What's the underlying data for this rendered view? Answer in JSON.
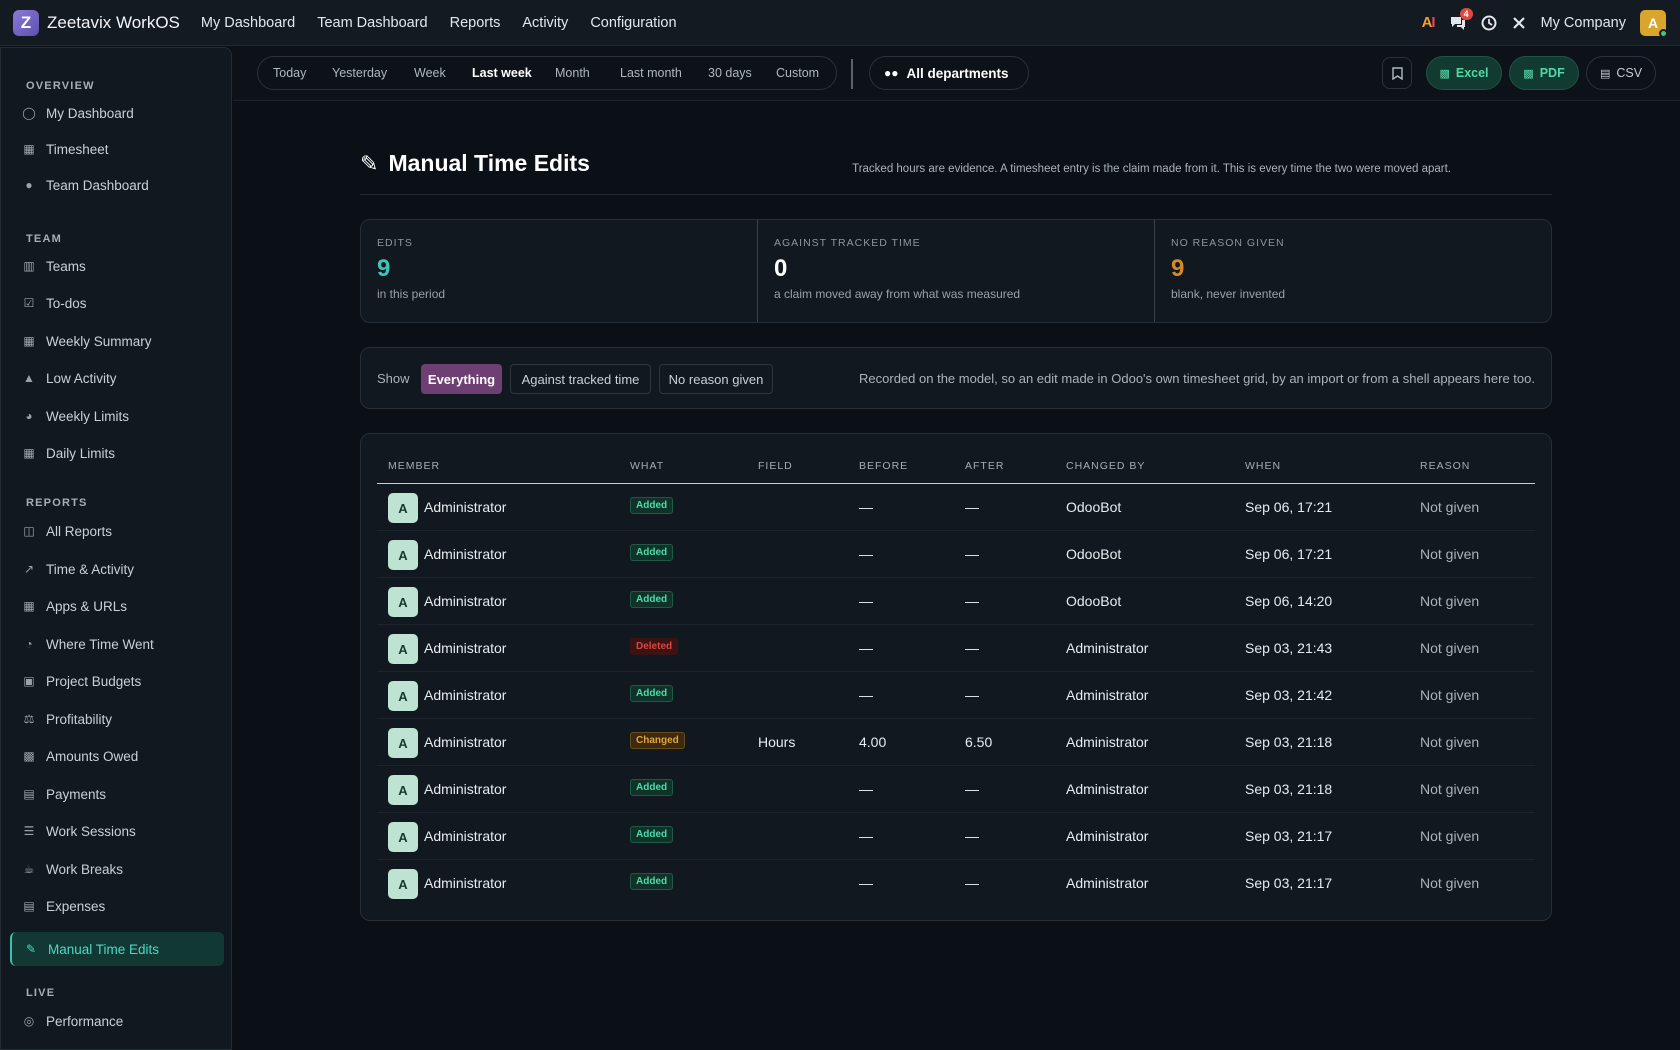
{
  "app": {
    "logo_letter": "Z",
    "name": "Zeetavix WorkOS",
    "nav": [
      "My Dashboard",
      "Team Dashboard",
      "Reports",
      "Activity",
      "Configuration"
    ],
    "ai_label": "AI",
    "chat_badge": "4",
    "company": "My Company",
    "user_initial": "A"
  },
  "sidebar": {
    "sections": {
      "overview": "OVERVIEW",
      "team": "TEAM",
      "reports": "REPORTS",
      "live": "LIVE"
    },
    "items": [
      {
        "label": "My Dashboard",
        "icon": "user-icon"
      },
      {
        "label": "Timesheet",
        "icon": "calendar-icon"
      },
      {
        "label": "Team Dashboard",
        "icon": "users-icon"
      },
      {
        "label": "Teams",
        "icon": "sitemap-icon"
      },
      {
        "label": "To-dos",
        "icon": "checkbox-icon"
      },
      {
        "label": "Weekly Summary",
        "icon": "table-icon"
      },
      {
        "label": "Low Activity",
        "icon": "warning-icon"
      },
      {
        "label": "Weekly Limits",
        "icon": "gauge-icon"
      },
      {
        "label": "Daily Limits",
        "icon": "calendar-check-icon"
      },
      {
        "label": "All Reports",
        "icon": "folder-icon"
      },
      {
        "label": "Time & Activity",
        "icon": "line-chart-icon"
      },
      {
        "label": "Apps & URLs",
        "icon": "grid-icon"
      },
      {
        "label": "Where Time Went",
        "icon": "pie-chart-icon"
      },
      {
        "label": "Project Budgets",
        "icon": "briefcase-icon"
      },
      {
        "label": "Profitability",
        "icon": "scale-icon"
      },
      {
        "label": "Amounts Owed",
        "icon": "money-icon"
      },
      {
        "label": "Payments",
        "icon": "credit-card-icon"
      },
      {
        "label": "Work Sessions",
        "icon": "list-icon"
      },
      {
        "label": "Work Breaks",
        "icon": "coffee-icon"
      },
      {
        "label": "Expenses",
        "icon": "receipt-icon"
      },
      {
        "label": "Manual Time Edits",
        "icon": "edit-icon",
        "active": true
      },
      {
        "label": "Performance",
        "icon": "target-icon"
      }
    ]
  },
  "filters": {
    "ranges": [
      "Today",
      "Yesterday",
      "Week",
      "Last week",
      "Month",
      "Last month",
      "30 days",
      "Custom"
    ],
    "selected_range": "Last week",
    "department": "All departments",
    "export": {
      "excel": "Excel",
      "pdf": "PDF",
      "csv": "CSV"
    }
  },
  "page": {
    "title": "Manual Time Edits",
    "subtitle": "Tracked hours are evidence. A timesheet entry is the claim made from it. This is every time the two were moved apart."
  },
  "kpis": [
    {
      "label": "EDITS",
      "value": "9",
      "note": "in this period",
      "color": "#3cc6b6"
    },
    {
      "label": "AGAINST TRACKED TIME",
      "value": "0",
      "note": "a claim moved away from what was measured",
      "color": "#ffffff"
    },
    {
      "label": "NO REASON GIVEN",
      "value": "9",
      "note": "blank, never invented",
      "color": "#d58a24"
    }
  ],
  "show": {
    "label": "Show",
    "options": [
      "Everything",
      "Against tracked time",
      "No reason given"
    ],
    "selected": "Everything",
    "note": "Recorded on the model, so an edit made in Odoo's own timesheet grid, by an import or from a shell appears here too."
  },
  "table": {
    "headers": [
      "MEMBER",
      "WHAT",
      "FIELD",
      "BEFORE",
      "AFTER",
      "CHANGED BY",
      "WHEN",
      "REASON"
    ],
    "rows": [
      {
        "initial": "A",
        "member": "Administrator",
        "what": "Added",
        "field": "",
        "before": "—",
        "after": "—",
        "changed_by": "OdooBot",
        "when": "Sep 06, 17:21",
        "reason": "Not given"
      },
      {
        "initial": "A",
        "member": "Administrator",
        "what": "Added",
        "field": "",
        "before": "—",
        "after": "—",
        "changed_by": "OdooBot",
        "when": "Sep 06, 17:21",
        "reason": "Not given"
      },
      {
        "initial": "A",
        "member": "Administrator",
        "what": "Added",
        "field": "",
        "before": "—",
        "after": "—",
        "changed_by": "OdooBot",
        "when": "Sep 06, 14:20",
        "reason": "Not given"
      },
      {
        "initial": "A",
        "member": "Administrator",
        "what": "Deleted",
        "field": "",
        "before": "—",
        "after": "—",
        "changed_by": "Administrator",
        "when": "Sep 03, 21:43",
        "reason": "Not given"
      },
      {
        "initial": "A",
        "member": "Administrator",
        "what": "Added",
        "field": "",
        "before": "—",
        "after": "—",
        "changed_by": "Administrator",
        "when": "Sep 03, 21:42",
        "reason": "Not given"
      },
      {
        "initial": "A",
        "member": "Administrator",
        "what": "Changed",
        "field": "Hours",
        "before": "4.00",
        "after": "6.50",
        "changed_by": "Administrator",
        "when": "Sep 03, 21:18",
        "reason": "Not given"
      },
      {
        "initial": "A",
        "member": "Administrator",
        "what": "Added",
        "field": "",
        "before": "—",
        "after": "—",
        "changed_by": "Administrator",
        "when": "Sep 03, 21:18",
        "reason": "Not given"
      },
      {
        "initial": "A",
        "member": "Administrator",
        "what": "Added",
        "field": "",
        "before": "—",
        "after": "—",
        "changed_by": "Administrator",
        "when": "Sep 03, 21:17",
        "reason": "Not given"
      },
      {
        "initial": "A",
        "member": "Administrator",
        "what": "Added",
        "field": "",
        "before": "—",
        "after": "—",
        "changed_by": "Administrator",
        "when": "Sep 03, 21:17",
        "reason": "Not given"
      }
    ]
  }
}
